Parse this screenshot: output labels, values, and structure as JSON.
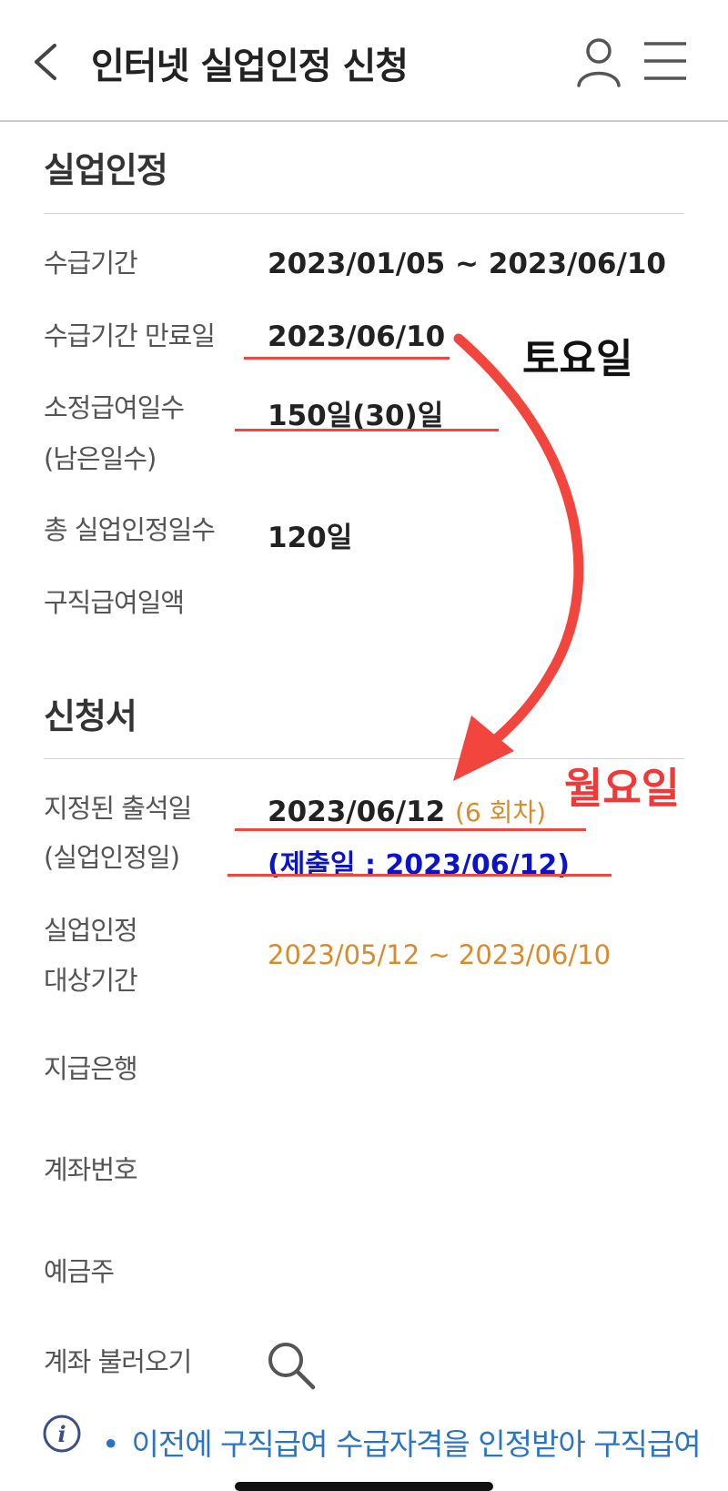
{
  "header": {
    "title": "인터넷 실업인정 신청"
  },
  "section1": {
    "title": "실업인정",
    "rows": [
      {
        "label": "수급기간",
        "value": "2023/01/05 ~ 2023/06/10"
      },
      {
        "label": "수급기간 만료일",
        "value": "2023/06/10"
      },
      {
        "label": "소정급여일수",
        "label2": "(남은일수)",
        "value": "150일(30)일"
      },
      {
        "label": "총 실업인정일수",
        "value": "120일"
      },
      {
        "label": "구직급여일액",
        "value": ""
      }
    ]
  },
  "section2": {
    "title": "신청서",
    "attendance": {
      "label": "지정된 출석일",
      "label2": "(실업인정일)",
      "date": "2023/06/12",
      "round": "(6 회차)",
      "submit": "(제출일 : 2023/06/12)"
    },
    "period": {
      "label": "실업인정",
      "label2": "대상기간",
      "value": "2023/05/12  ~  2023/06/10"
    },
    "bank": {
      "label": "지급은행"
    },
    "account": {
      "label": "계좌번호"
    },
    "holder": {
      "label": "예금주"
    },
    "load": {
      "label": "계좌 불러오기"
    }
  },
  "annotations": {
    "saturday": "토요일",
    "monday": "월요일"
  },
  "notice": {
    "bullet": "•",
    "text": "이전에 구직급여 수급자격을 인정받아 구직급여"
  },
  "icons": [
    "back-arrow-icon",
    "user-icon",
    "hamburger-menu-icon",
    "search-icon",
    "info-icon"
  ],
  "colors": {
    "accent_orange": "#d98b2b",
    "annotation_red": "#f2453d",
    "submit_blue": "#0b14c8",
    "notice_blue": "#2a74c6"
  }
}
